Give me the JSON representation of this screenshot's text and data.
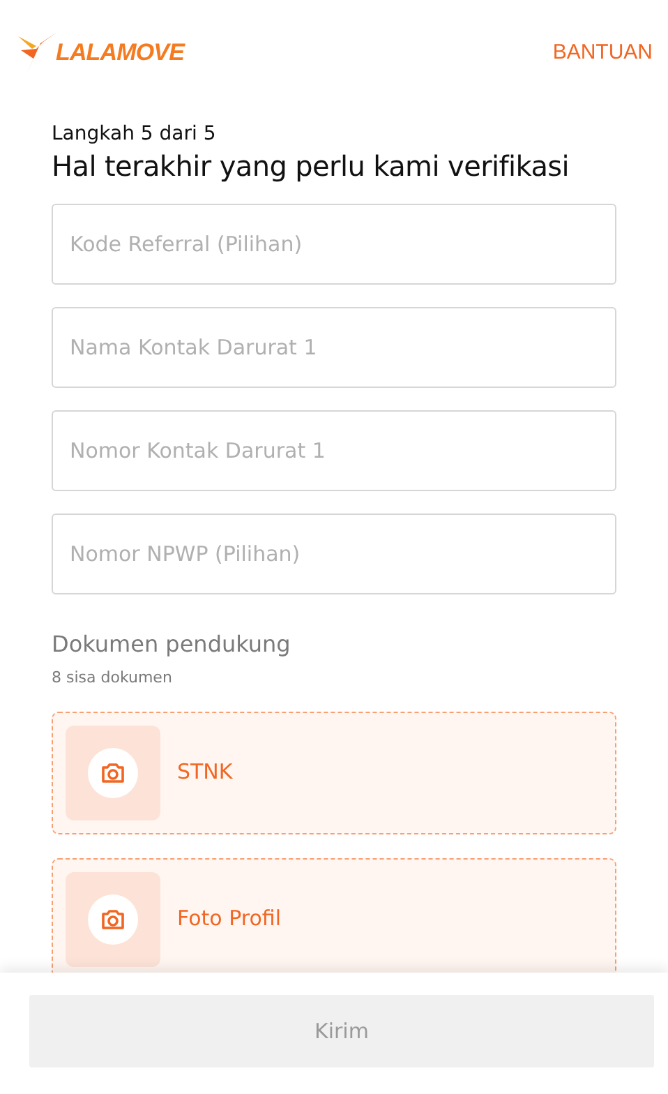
{
  "header": {
    "logo_text": "LALAMOVE",
    "help_link": "BANTUAN"
  },
  "step": "Langkah 5 dari 5",
  "title": "Hal terakhir yang perlu kami verifikasi",
  "fields": [
    {
      "placeholder": "Kode Referral (Pilihan)"
    },
    {
      "placeholder": "Nama Kontak Darurat 1"
    },
    {
      "placeholder": "Nomor Kontak Darurat 1"
    },
    {
      "placeholder": "Nomor NPWP (Pilihan)"
    }
  ],
  "documents": {
    "heading": "Dokumen pendukung",
    "remaining": "8 sisa dokumen",
    "items": [
      {
        "label": "STNK"
      },
      {
        "label": "Foto Profil"
      }
    ]
  },
  "submit": {
    "label": "Kirim",
    "disabled": true
  }
}
